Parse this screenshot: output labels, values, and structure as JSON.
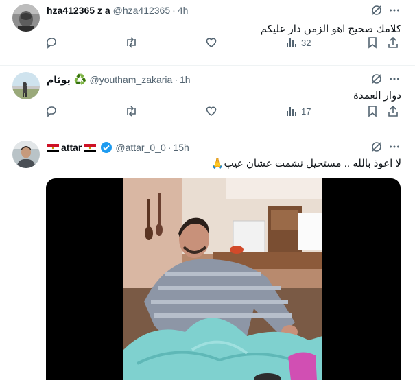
{
  "tweets": [
    {
      "display_name": "hza412365 z a",
      "handle": "@hza412365",
      "dot": "·",
      "time": "4h",
      "text": "كلامك صحيح اهو الزمن دار عليكم",
      "views": "32"
    },
    {
      "display_name": "يوثام",
      "name_emoji": "♻️",
      "handle": "@youtham_zakaria",
      "dot": "·",
      "time": "1h",
      "text": "دوار العمدة",
      "views": "17"
    },
    {
      "display_name": "attar",
      "handle": "@attar_0_0",
      "dot": "·",
      "time": "15h",
      "text": "لا اعوذ بالله .. مستحيل نشمت عشان عيب🙏"
    }
  ],
  "icons": {
    "grok": "grok-icon",
    "more": "more-icon",
    "reply": "reply-icon",
    "retweet": "retweet-icon",
    "like": "like-icon",
    "views": "views-icon",
    "bookmark": "bookmark-icon",
    "share": "share-icon",
    "verified": "verified-badge-icon",
    "flag": "egypt-flag-icon"
  },
  "colors": {
    "text": "#0f1419",
    "secondary": "#536471",
    "verified": "#1d9bf0",
    "divider": "#eff3f4"
  }
}
